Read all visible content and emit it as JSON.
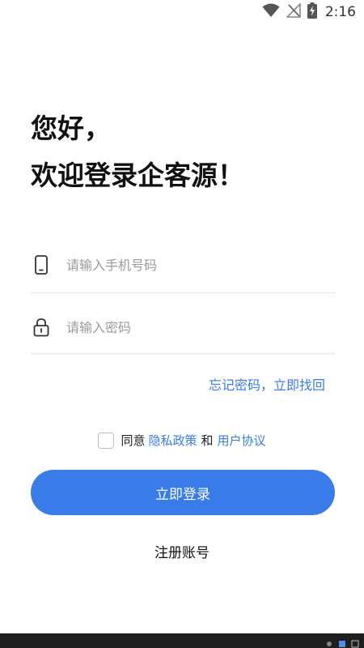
{
  "status_bar": {
    "time": "2:16",
    "icons": [
      "wifi-icon",
      "no-signal-icon",
      "battery-charging-icon"
    ]
  },
  "greeting": {
    "line1": "您好，",
    "line2": "欢迎登录企客源！"
  },
  "phone_field": {
    "placeholder": "请输入手机号码",
    "value": "",
    "icon": "phone-icon"
  },
  "password_field": {
    "placeholder": "请输入密码",
    "value": "",
    "icon": "lock-icon"
  },
  "forgot_password": "忘记密码，立即找回",
  "agreement": {
    "prefix": "同意",
    "privacy_policy": "隐私政策",
    "conjunction": "和",
    "user_agreement": "用户协议",
    "checked": false
  },
  "login_button": "立即登录",
  "register_link": "注册账号",
  "colors": {
    "accent": "#3a7bea",
    "bottom_bar": "#1f1f1f"
  }
}
